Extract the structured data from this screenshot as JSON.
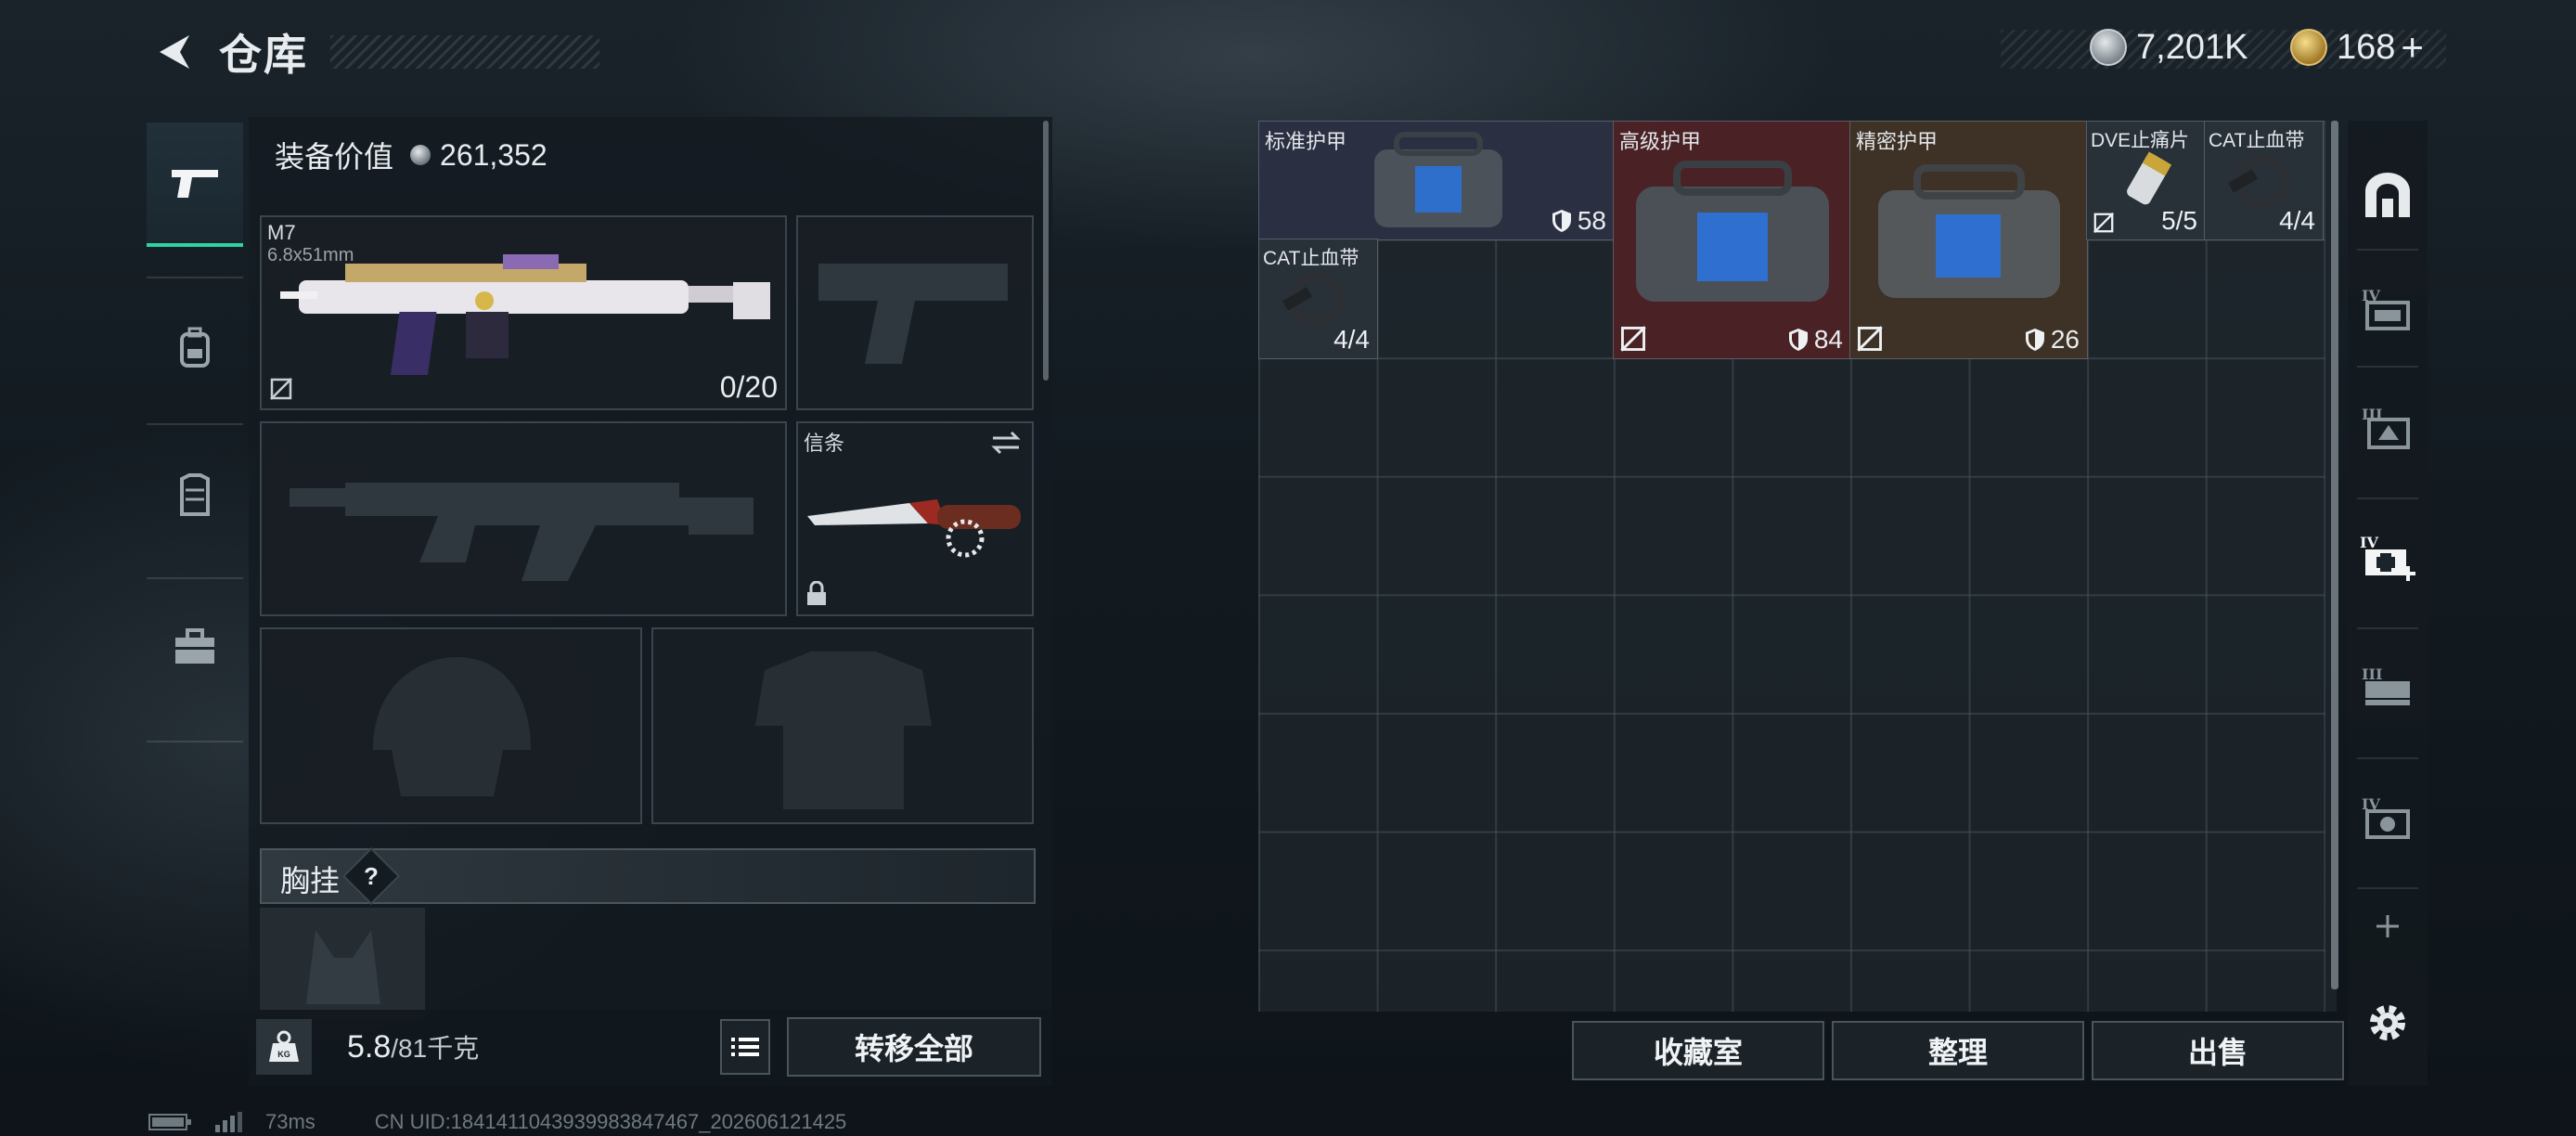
{
  "header": {
    "title": "仓库",
    "currency1": "7,201K",
    "currency2": "168",
    "currency2_add": "+"
  },
  "side_tabs": [
    {
      "icon": "pistol-icon",
      "active": true
    },
    {
      "icon": "backpack-icon",
      "active": false
    },
    {
      "icon": "vest-icon",
      "active": false
    },
    {
      "icon": "toolbox-icon",
      "active": false
    }
  ],
  "equipment": {
    "value_label": "装备价值",
    "value": "261,352",
    "primary_weapon": {
      "name": "M7",
      "caliber": "6.8x51mm",
      "ammo": "0/20"
    },
    "melee": {
      "name": "信条"
    },
    "chest_rig_label": "胸挂",
    "chest_rig_help": "?",
    "weight_current": "5.8",
    "weight_max": "/81千克",
    "transfer_all": "转移全部"
  },
  "stash": {
    "items": [
      {
        "name": "标准护甲",
        "durability": "58",
        "color": "#2b2f42"
      },
      {
        "name": "高级护甲",
        "durability": "84",
        "color": "#4a2226"
      },
      {
        "name": "精密护甲",
        "durability": "26",
        "color": "#3e3126"
      },
      {
        "name": "DVE止痛片",
        "qty": "5/5"
      },
      {
        "name": "CAT止血带",
        "qty": "4/4"
      },
      {
        "name": "CAT止血带",
        "qty": "4/4"
      }
    ],
    "buttons": {
      "collection": "收藏室",
      "sort": "整理",
      "sell": "出售"
    }
  },
  "right_rail": [
    "stash-arch-icon",
    "container-iv-icon",
    "container-iii-icon",
    "medkit-iv-icon",
    "case-iii-icon",
    "case-iv-icon",
    "add-icon",
    "settings-icon"
  ],
  "status": {
    "ping": "73ms",
    "uid": "CN UID:1841411043939983847467_202606121425"
  },
  "colors": {
    "accent": "#2fd3a0"
  }
}
